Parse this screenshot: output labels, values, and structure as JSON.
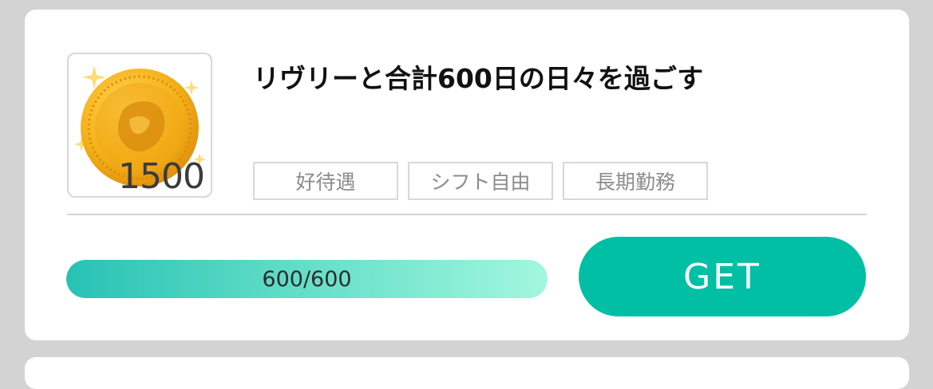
{
  "mission": {
    "title": "リヴリーと合計600日の日々を過ごす",
    "reward": {
      "amount": "1500",
      "icon": "gold-coin-icon"
    },
    "tags": [
      {
        "label": "好待遇"
      },
      {
        "label": "シフト自由"
      },
      {
        "label": "長期勤務"
      }
    ],
    "progress": {
      "current": 600,
      "total": 600,
      "fraction": 1.0,
      "label": "600/600"
    },
    "get_button_label": "GET"
  },
  "colors": {
    "background": "#d3d3d3",
    "card": "#ffffff",
    "accent": "#00bfa5",
    "progress_start": "#27c2b4",
    "progress_end": "#a2f7de",
    "tag_border": "#d6d8de",
    "tag_text": "#8c8c8c",
    "coin": "#f5b21a"
  }
}
